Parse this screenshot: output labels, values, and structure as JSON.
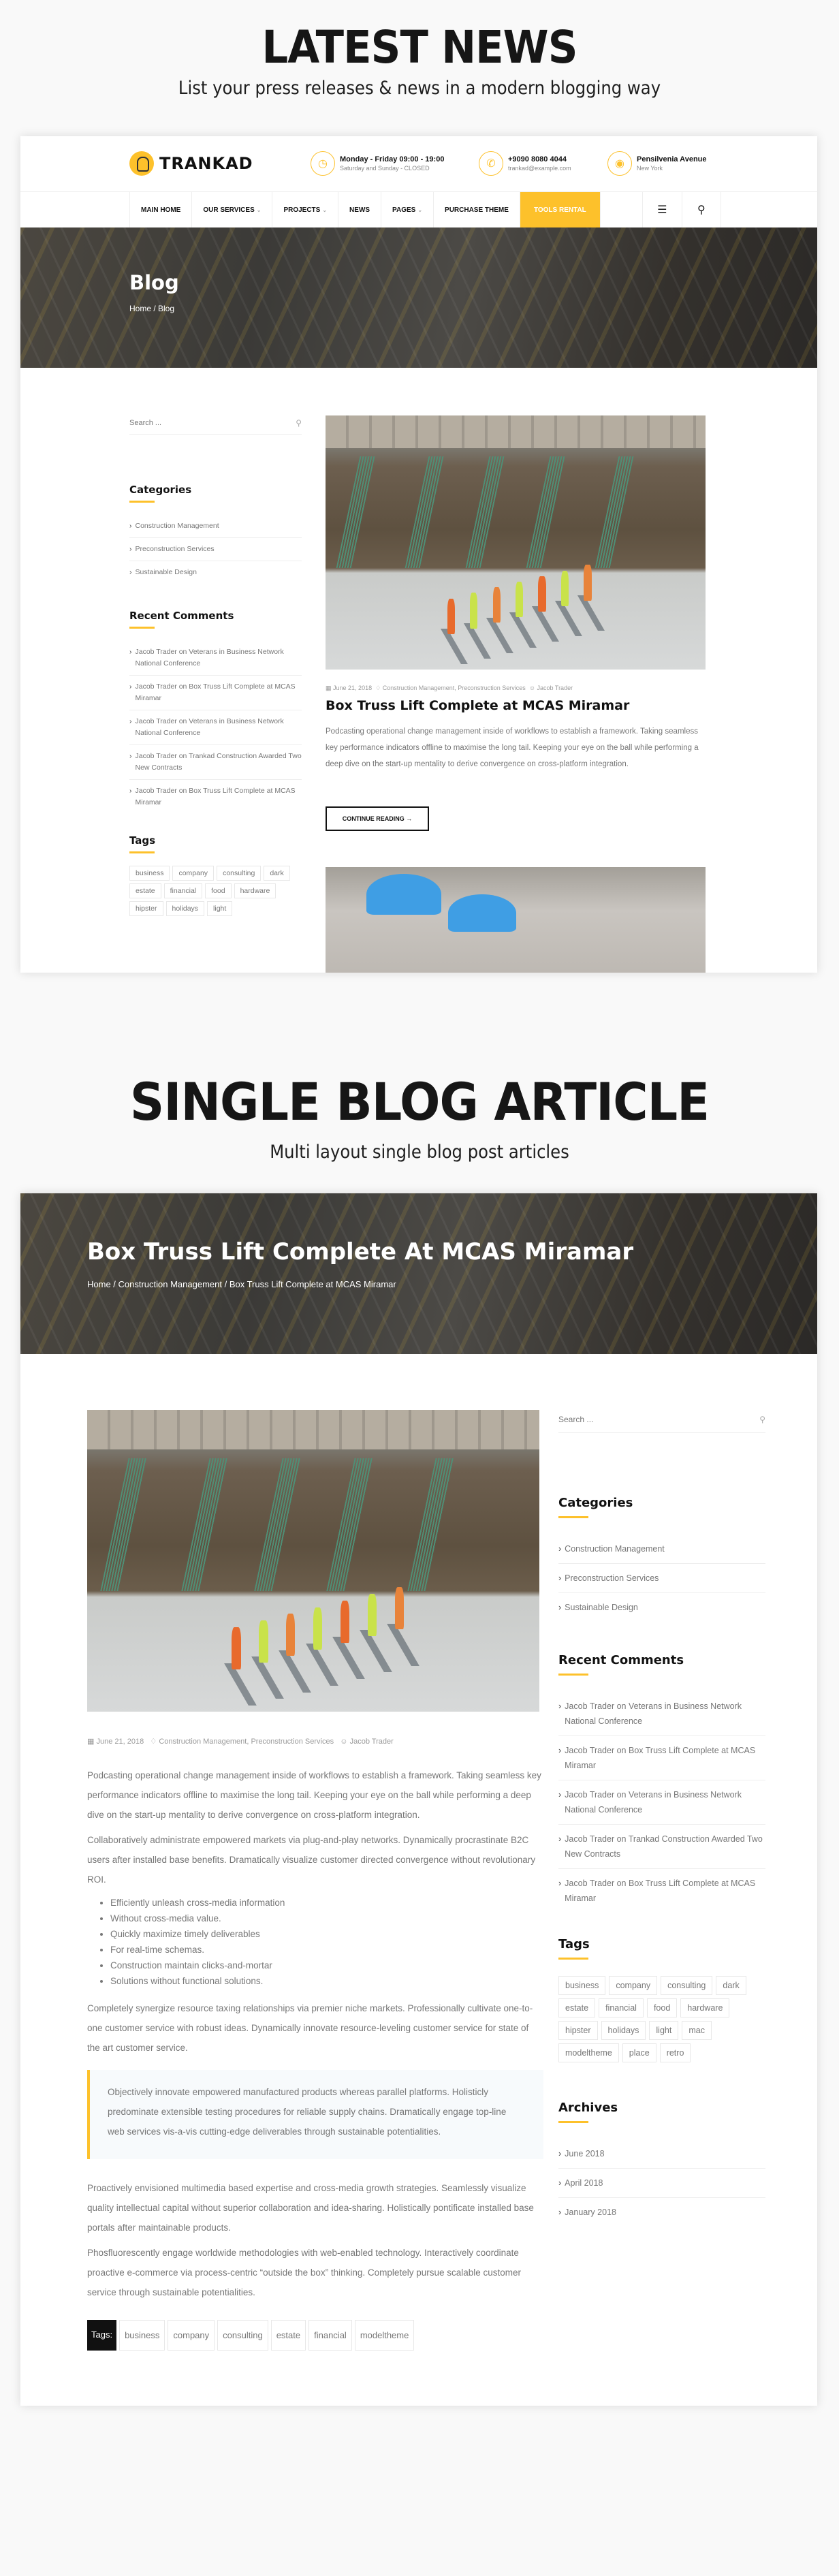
{
  "section1": {
    "title": "LATEST NEWS",
    "subtitle": "List your press releases & news in a modern blogging way"
  },
  "section2": {
    "title": "SINGLE BLOG ARTICLE",
    "subtitle": "Multi layout single blog post articles"
  },
  "brand": {
    "name": "TRANKAD",
    "accent_color": "#fdc12b"
  },
  "header": {
    "hours": {
      "icon": "clock-icon",
      "main": "Monday - Friday 09:00 - 19:00",
      "sub": "Saturday and Sunday - CLOSED"
    },
    "phone": {
      "icon": "phone-icon",
      "main": "+9090 8080 4044",
      "sub": "trankad@example.com"
    },
    "address": {
      "icon": "map-pin-icon",
      "main": "Pensilvenia Avenue",
      "sub": "New York"
    }
  },
  "nav": {
    "items": [
      {
        "label": "MAIN HOME",
        "dropdown": false
      },
      {
        "label": "OUR SERVICES",
        "dropdown": true
      },
      {
        "label": "PROJECTS",
        "dropdown": true
      },
      {
        "label": "NEWS",
        "dropdown": false
      },
      {
        "label": "PAGES",
        "dropdown": true
      },
      {
        "label": "PURCHASE THEME",
        "dropdown": false
      },
      {
        "label": "TOOLS RENTAL",
        "dropdown": false,
        "active": true
      }
    ],
    "menu_icon": "hamburger-icon",
    "search_icon": "search-icon"
  },
  "blog_page": {
    "hero_title": "Blog",
    "breadcrumb": "Home / Blog",
    "post": {
      "date": "June 21, 2018",
      "categories": "Construction Management, Preconstruction Services",
      "author": "Jacob Trader",
      "title": "Box Truss Lift Complete at MCAS Miramar",
      "excerpt": "Podcasting operational change management inside of workflows to establish a framework. Taking seamless key performance indicators offline to maximise the long tail. Keeping your eye on the ball while performing a deep dive on the start-up mentality to derive convergence on cross-platform integration.",
      "button": "CONTINUE READING →"
    }
  },
  "sidebar": {
    "search_placeholder": "Search ...",
    "categories_title": "Categories",
    "categories": [
      "Construction Management",
      "Preconstruction Services",
      "Sustainable Design"
    ],
    "comments_title": "Recent Comments",
    "comments": [
      "Jacob Trader on Veterans in Business Network National Conference",
      "Jacob Trader on Box Truss Lift Complete at MCAS Miramar",
      "Jacob Trader on Veterans in Business Network National Conference",
      "Jacob Trader on Trankad Construction Awarded Two New Contracts",
      "Jacob Trader on Box Truss Lift Complete at MCAS Miramar"
    ],
    "tags_title": "Tags",
    "tags": [
      "business",
      "company",
      "consulting",
      "dark",
      "estate",
      "financial",
      "food",
      "hardware",
      "hipster",
      "holidays",
      "light",
      "mac",
      "modeltheme",
      "place",
      "retro"
    ],
    "archives_title": "Archives",
    "archives": [
      "June 2018",
      "April 2018",
      "January 2018"
    ]
  },
  "article_page": {
    "hero_title": "Box Truss Lift Complete At MCAS Miramar",
    "breadcrumb": "Home / Construction Management / Box Truss Lift Complete at MCAS Miramar",
    "date": "June 21, 2018",
    "categories": "Construction Management, Preconstruction Services",
    "author": "Jacob Trader",
    "paragraphs": [
      "Podcasting operational change management inside of workflows to establish a framework. Taking seamless key performance indicators offline to maximise the long tail. Keeping your eye on the ball while performing a deep dive on the start-up mentality to derive convergence on cross-platform integration.",
      "Collaboratively administrate empowered markets via plug-and-play networks. Dynamically procrastinate B2C users after installed base benefits. Dramatically visualize customer directed convergence without revolutionary ROI."
    ],
    "bullets": [
      "Efficiently unleash cross-media information",
      "Without cross-media value.",
      "Quickly maximize timely deliverables",
      "For real-time schemas.",
      "Construction maintain clicks-and-mortar",
      "Solutions without functional solutions."
    ],
    "paragraph3": "Completely synergize resource taxing relationships via premier niche markets. Professionally cultivate one-to-one customer service with robust ideas. Dynamically innovate resource-leveling customer service for state of the art customer service.",
    "quote": "Objectively innovate empowered manufactured products whereas parallel platforms. Holisticly predominate extensible testing procedures for reliable supply chains. Dramatically engage top-line web services vis-a-vis cutting-edge deliverables through sustainable potentialities.",
    "paragraph4": "Proactively envisioned multimedia based expertise and cross-media growth strategies. Seamlessly visualize quality intellectual capital without superior collaboration and idea-sharing. Holistically pontificate installed base portals after maintainable products.",
    "paragraph5": "Phosfluorescently engage worldwide methodologies with web-enabled technology. Interactively coordinate proactive e-commerce via process-centric “outside the box” thinking. Completely pursue scalable customer service through sustainable potentialities.",
    "tags_label": "Tags:",
    "tags": [
      "business",
      "company",
      "consulting",
      "estate",
      "financial",
      "modeltheme"
    ]
  }
}
